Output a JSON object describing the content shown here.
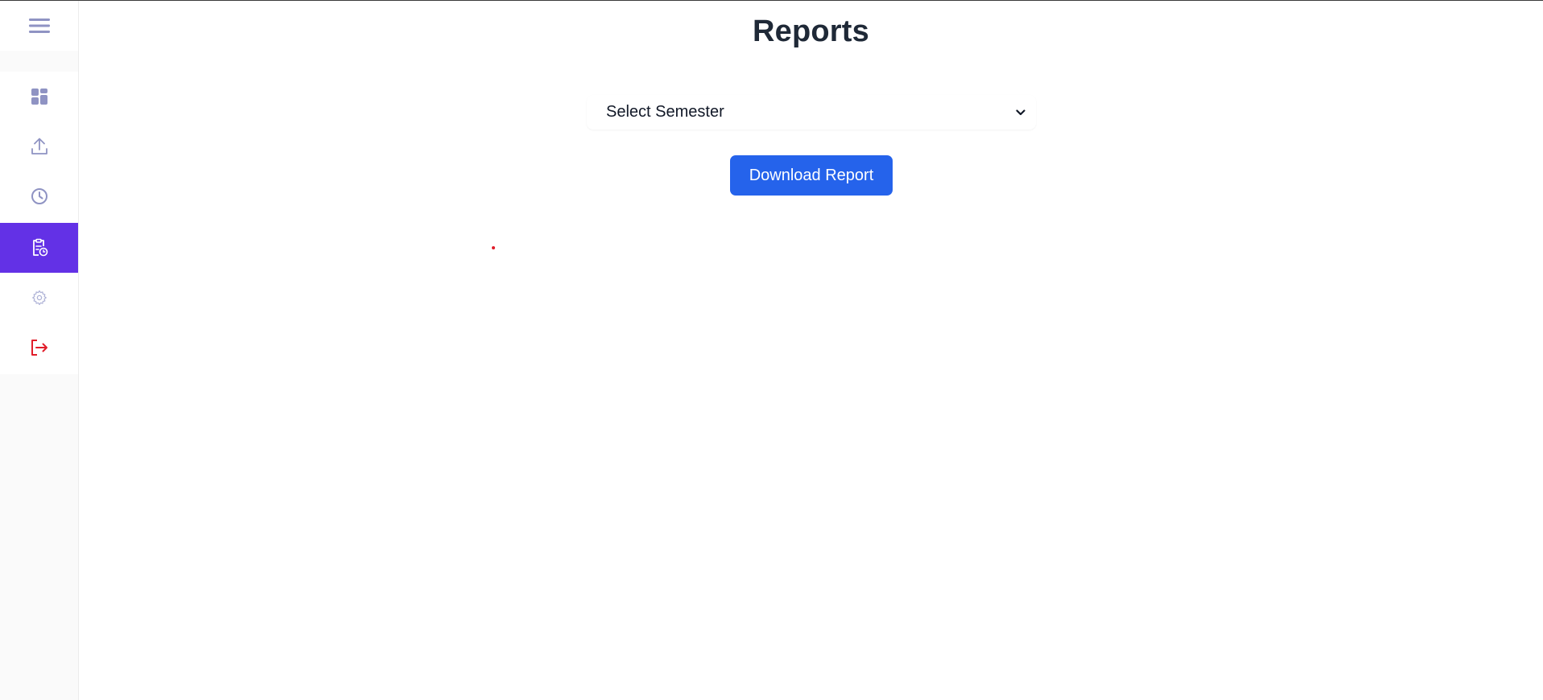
{
  "page": {
    "title": "Reports"
  },
  "form": {
    "semester_select": {
      "selected_text": "Select Semester"
    },
    "download_button_label": "Download Report"
  },
  "sidebar": {
    "toggle_icon": "hamburger-menu-icon",
    "items": [
      {
        "icon": "dashboard-icon",
        "active": false
      },
      {
        "icon": "upload-icon",
        "active": false
      },
      {
        "icon": "clock-icon",
        "active": false
      },
      {
        "icon": "clipboard-report-icon",
        "active": true
      },
      {
        "icon": "gear-icon",
        "active": false
      },
      {
        "icon": "logout-icon",
        "active": false
      }
    ]
  },
  "colors": {
    "active_nav": "#6331e6",
    "primary_button": "#2563eb",
    "icon_default": "#8f93c3",
    "logout_icon": "#e11d2a"
  }
}
